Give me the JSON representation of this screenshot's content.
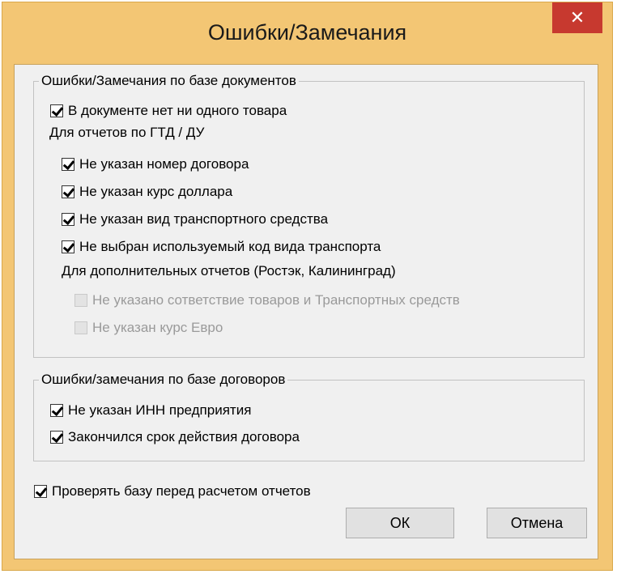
{
  "window": {
    "title": "Ошибки/Замечания",
    "close_glyph": "✕"
  },
  "documents_group": {
    "legend": "Ошибки/Замечания по базе документов",
    "no_goods": {
      "label": "В документе нет ни одного товара",
      "checked": true
    },
    "gtd_section_label": "Для отчетов по ГТД / ДУ",
    "gtd_items": [
      {
        "label": "Не указан номер договора",
        "checked": true
      },
      {
        "label": "Не указан курс доллара",
        "checked": true
      },
      {
        "label": "Не указан вид транспортного средства",
        "checked": true
      },
      {
        "label": "Не выбран используемый код вида транспорта",
        "checked": true
      }
    ],
    "extra_section_label": "Для дополнительных отчетов (Ростэк, Калининград)",
    "extra_items": [
      {
        "label": "Не указано сответствие товаров и Транспортных средств",
        "checked": false,
        "disabled": true
      },
      {
        "label": "Не указан курс Евро",
        "checked": false,
        "disabled": true
      }
    ]
  },
  "contracts_group": {
    "legend": "Ошибки/замечания по базе договоров",
    "items": [
      {
        "label": "Не указан ИНН предприятия",
        "checked": true
      },
      {
        "label": "Закончился срок действия договора",
        "checked": true
      }
    ]
  },
  "check_before": {
    "label": "Проверять базу перед расчетом отчетов",
    "checked": true
  },
  "buttons": {
    "ok": "ОК",
    "cancel": "Отмена"
  }
}
